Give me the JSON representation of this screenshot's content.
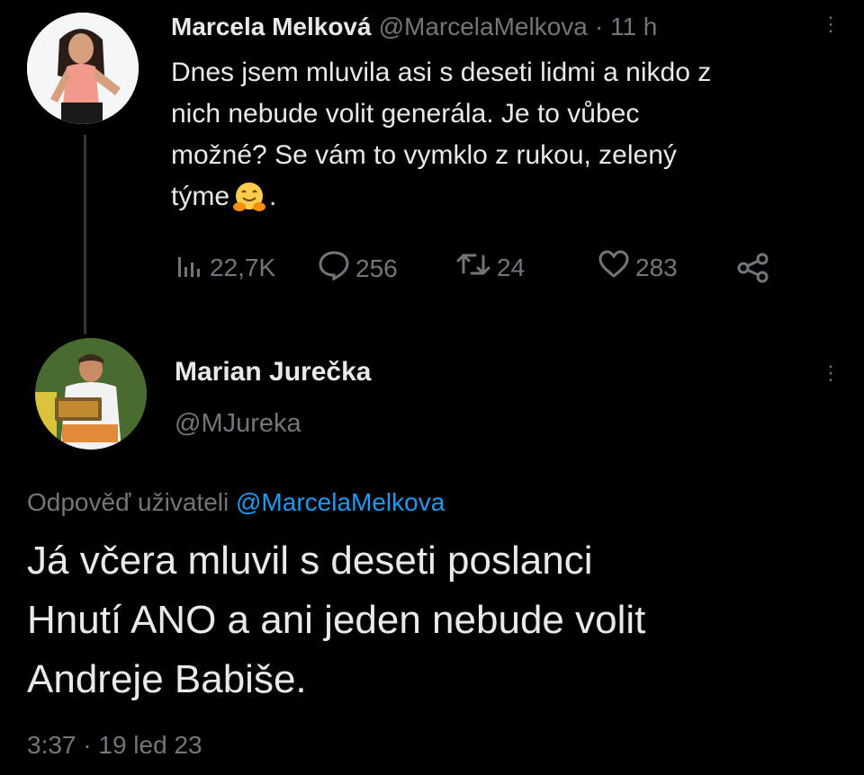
{
  "tweet1": {
    "author_name": "Marcela Melková",
    "handle": "@MarcelaMelkova",
    "time": "· 11 h",
    "text_lines": [
      "Dnes jsem mluvila asi s deseti lidmi a nikdo z",
      "nich nebude volit generála. Je to vůbec",
      "možné? Se vám to vymklo z rukou, zelený",
      "týme"
    ],
    "text_suffix": ".",
    "emoji_icon": "hugging-face-emoji",
    "stats": {
      "views": "22,7K",
      "replies": "256",
      "retweets": "24",
      "likes": "283"
    },
    "icons": [
      "views-icon",
      "reply-icon",
      "retweet-icon",
      "like-icon",
      "share-icon",
      "more-options-icon"
    ]
  },
  "tweet2": {
    "author_name": "Marian Jurečka",
    "handle": "@MJureka",
    "reply_prefix": "Odpověď uživateli",
    "reply_to": "@MarcelaMelkova",
    "text_lines": [
      "Já včera mluvil s deseti poslanci",
      "Hnutí ANO a ani jeden nebude volit",
      "Andreje Babiše."
    ],
    "timestamp": "3:37 · 19 led 23"
  },
  "colors": {
    "background": "#000000",
    "text": "#e7e9ea",
    "muted": "#71767b",
    "accent": "#1d9bf0"
  }
}
